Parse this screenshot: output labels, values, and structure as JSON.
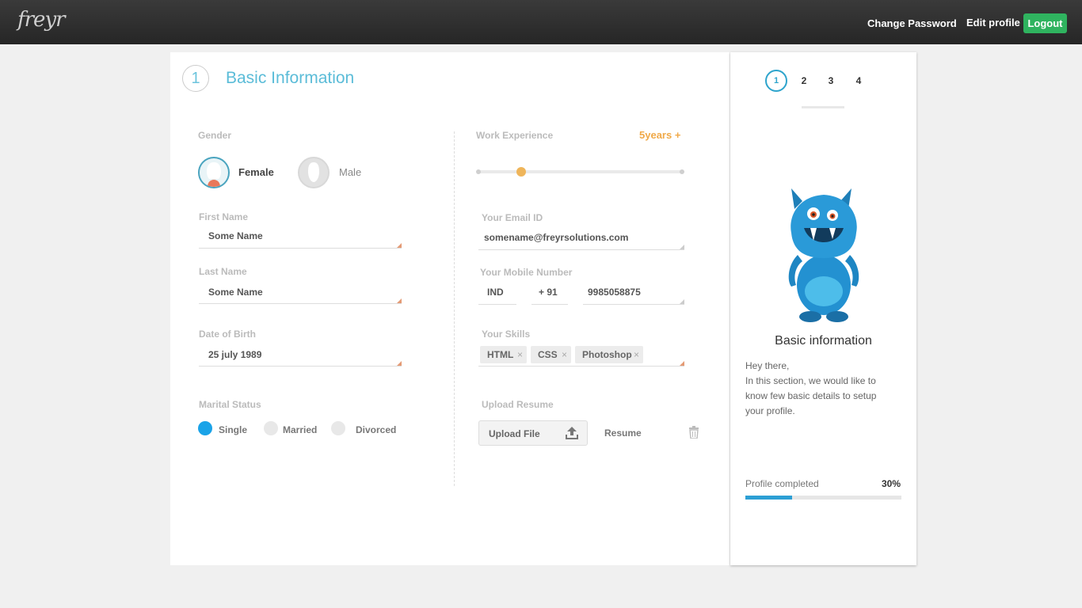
{
  "header": {
    "logo": "freyr",
    "links": {
      "change_password": "Change Password",
      "edit_profile": "Edit profile",
      "logout": "Logout"
    }
  },
  "form": {
    "step_number": "1",
    "title": "Basic Information",
    "gender": {
      "label": "Gender",
      "female": "Female",
      "male": "Male",
      "selected": "Female"
    },
    "first_name": {
      "label": "First Name",
      "value": "Some Name"
    },
    "last_name": {
      "label": "Last Name",
      "value": "Some Name"
    },
    "dob": {
      "label": "Date of Birth",
      "value": "25 july 1989"
    },
    "marital": {
      "label": "Marital Status",
      "options": [
        "Single",
        "Married",
        "Divorced"
      ],
      "selected": "Single"
    },
    "experience": {
      "label": "Work Experience",
      "value": "5years +",
      "slider_fraction": 0.2
    },
    "email": {
      "label": "Your Email ID",
      "value": "somename@freyrsolutions.com"
    },
    "mobile": {
      "label": "Your Mobile Number",
      "country": "IND",
      "code": "+ 91",
      "number": "9985058875"
    },
    "skills": {
      "label": "Your Skills",
      "items": [
        "HTML",
        "CSS",
        "Photoshop"
      ],
      "remove_glyph": "×"
    },
    "resume": {
      "label": "Upload Resume",
      "upload_button": "Upload File",
      "file_name": "Resume"
    }
  },
  "sidebar": {
    "steps": [
      "1",
      "2",
      "3",
      "4"
    ],
    "active_step": "1",
    "title": "Basic information",
    "text_lines": [
      "Hey there,",
      "In this section, we would like to",
      "know few basic details to setup",
      "your profile."
    ],
    "progress": {
      "label": "Profile completed",
      "percent_text": "30%",
      "fraction": 0.3
    }
  },
  "colors": {
    "accent": "#5bbcd8",
    "logout": "#2fb35f",
    "experience": "#f0a948",
    "progress": "#2c9fd4",
    "radio_on": "#1aa3e8"
  }
}
